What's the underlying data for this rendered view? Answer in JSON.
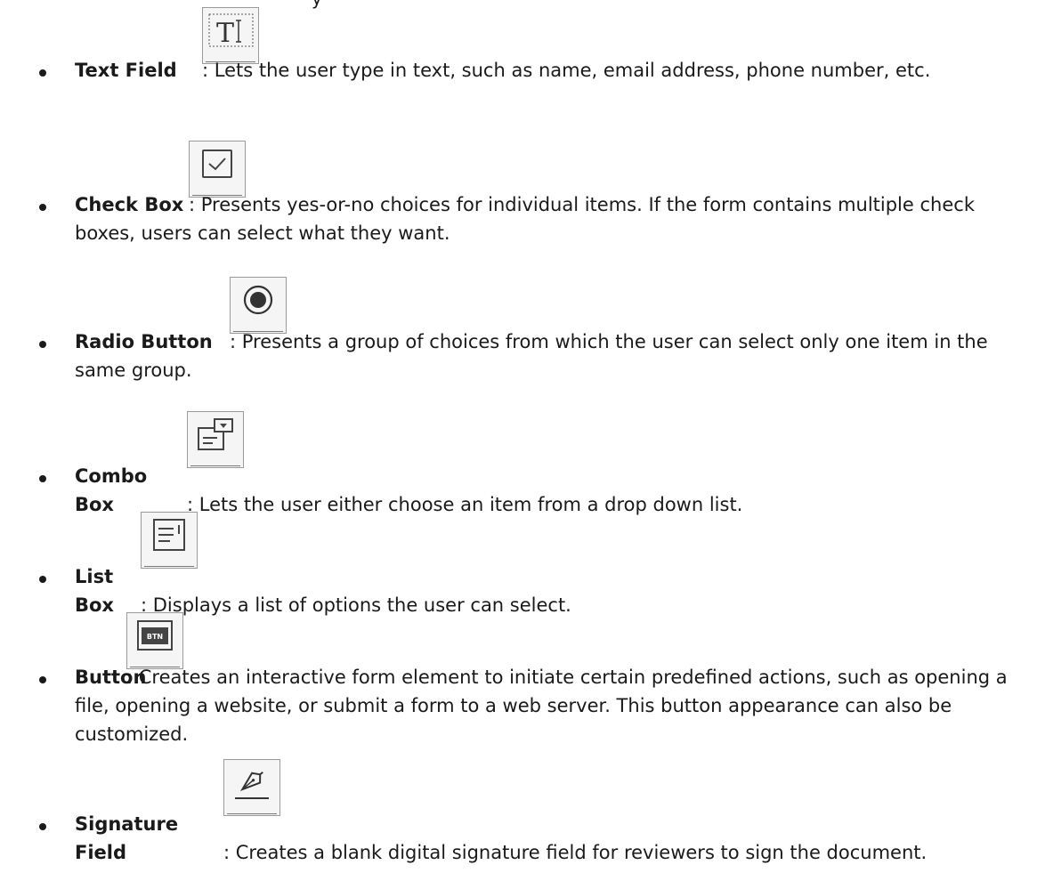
{
  "top_fragment": "y",
  "items": [
    {
      "label": "Text Field",
      "icon": "text-field-icon",
      "description": ": Lets the user type in text, such as name, email address, phone number, etc."
    },
    {
      "label": "Check Box",
      "icon": "check-box-icon",
      "description": ": Presents yes-or-no choices for individual items. If the form contains multiple check boxes, users can select what they want."
    },
    {
      "label": "Radio Button",
      "icon": "radio-button-icon",
      "description": ": Presents a group of choices from which the user can select only one item in the same group."
    },
    {
      "label": "Combo Box",
      "icon": "combo-box-icon",
      "description": ": Lets the user either choose an item from a drop down list."
    },
    {
      "label": "List Box",
      "icon": "list-box-icon",
      "description": ": Displays a list of options the user can select."
    },
    {
      "label": "Button",
      "icon": "button-icon",
      "icon_text": "BTN",
      "description": ": Creates an interactive form element to initiate certain predefined actions, such as opening a file, opening a website, or submit a form to a web server. This button appearance can also be customized."
    },
    {
      "label": "Signature Field",
      "icon": "signature-field-icon",
      "description": ": Creates a blank digital signature field for reviewers to sign the document."
    }
  ]
}
